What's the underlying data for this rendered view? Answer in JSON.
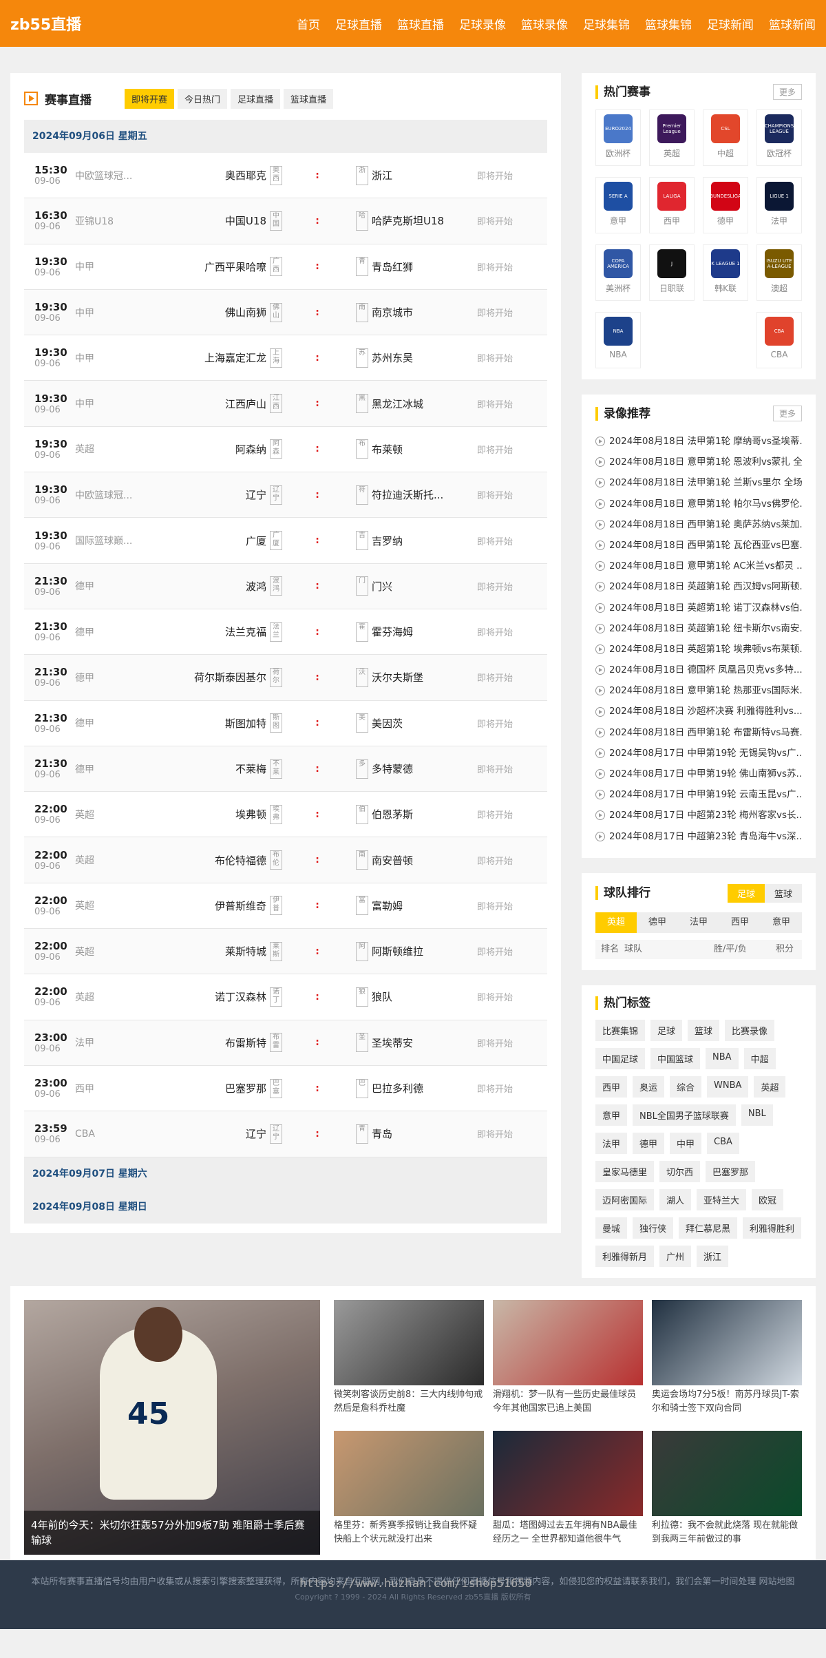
{
  "header": {
    "logo": "zb55直播",
    "nav": [
      "首页",
      "足球直播",
      "篮球直播",
      "足球录像",
      "篮球录像",
      "足球集锦",
      "篮球集锦",
      "足球新闻",
      "篮球新闻"
    ]
  },
  "live": {
    "title": "赛事直播",
    "filters": [
      "即将开赛",
      "今日热门",
      "足球直播",
      "篮球直播"
    ],
    "day1": "2024年09月06日 星期五",
    "day2": "2024年09月07日 星期六",
    "day3": "2024年09月08日 星期日",
    "vs": ":",
    "matches": [
      {
        "time": "15:30",
        "date": "09-06",
        "league": "中欧篮球冠...",
        "home": "奥西耶克",
        "hl": "奥西",
        "al": "浙",
        "away": "浙江",
        "status": "即将开始"
      },
      {
        "time": "16:30",
        "date": "09-06",
        "league": "亚锦U18",
        "home": "中国U18",
        "hl": "中国",
        "al": "哈",
        "away": "哈萨克斯坦U18",
        "status": "即将开始"
      },
      {
        "time": "19:30",
        "date": "09-06",
        "league": "中甲",
        "home": "广西平果哈嘹",
        "hl": "广西",
        "al": "青",
        "away": "青岛红狮",
        "status": "即将开始"
      },
      {
        "time": "19:30",
        "date": "09-06",
        "league": "中甲",
        "home": "佛山南狮",
        "hl": "佛山",
        "al": "南",
        "away": "南京城市",
        "status": "即将开始"
      },
      {
        "time": "19:30",
        "date": "09-06",
        "league": "中甲",
        "home": "上海嘉定汇龙",
        "hl": "上海",
        "al": "苏",
        "away": "苏州东吴",
        "status": "即将开始"
      },
      {
        "time": "19:30",
        "date": "09-06",
        "league": "中甲",
        "home": "江西庐山",
        "hl": "江西",
        "al": "黑",
        "away": "黑龙江冰城",
        "status": "即将开始"
      },
      {
        "time": "19:30",
        "date": "09-06",
        "league": "英超",
        "home": "阿森纳",
        "hl": "阿森",
        "al": "布",
        "away": "布莱顿",
        "status": "即将开始"
      },
      {
        "time": "19:30",
        "date": "09-06",
        "league": "中欧篮球冠...",
        "home": "辽宁",
        "hl": "辽宁",
        "al": "符",
        "away": "符拉迪沃斯托...",
        "status": "即将开始"
      },
      {
        "time": "19:30",
        "date": "09-06",
        "league": "国际篮球巅...",
        "home": "广厦",
        "hl": "广厦",
        "al": "吉",
        "away": "吉罗纳",
        "status": "即将开始"
      },
      {
        "time": "21:30",
        "date": "09-06",
        "league": "德甲",
        "home": "波鸿",
        "hl": "波鸿",
        "al": "门",
        "away": "门兴",
        "status": "即将开始"
      },
      {
        "time": "21:30",
        "date": "09-06",
        "league": "德甲",
        "home": "法兰克福",
        "hl": "法兰",
        "al": "霍",
        "away": "霍芬海姆",
        "status": "即将开始"
      },
      {
        "time": "21:30",
        "date": "09-06",
        "league": "德甲",
        "home": "荷尔斯泰因基尔",
        "hl": "荷尔",
        "al": "沃",
        "away": "沃尔夫斯堡",
        "status": "即将开始"
      },
      {
        "time": "21:30",
        "date": "09-06",
        "league": "德甲",
        "home": "斯图加特",
        "hl": "斯图",
        "al": "美",
        "away": "美因茨",
        "status": "即将开始"
      },
      {
        "time": "21:30",
        "date": "09-06",
        "league": "德甲",
        "home": "不莱梅",
        "hl": "不莱",
        "al": "多",
        "away": "多特蒙德",
        "status": "即将开始"
      },
      {
        "time": "22:00",
        "date": "09-06",
        "league": "英超",
        "home": "埃弗顿",
        "hl": "埃弗",
        "al": "伯",
        "away": "伯恩茅斯",
        "status": "即将开始"
      },
      {
        "time": "22:00",
        "date": "09-06",
        "league": "英超",
        "home": "布伦特福德",
        "hl": "布伦",
        "al": "南",
        "away": "南安普顿",
        "status": "即将开始"
      },
      {
        "time": "22:00",
        "date": "09-06",
        "league": "英超",
        "home": "伊普斯维奇",
        "hl": "伊普",
        "al": "富",
        "away": "富勒姆",
        "status": "即将开始"
      },
      {
        "time": "22:00",
        "date": "09-06",
        "league": "英超",
        "home": "莱斯特城",
        "hl": "莱斯",
        "al": "阿",
        "away": "阿斯顿维拉",
        "status": "即将开始"
      },
      {
        "time": "22:00",
        "date": "09-06",
        "league": "英超",
        "home": "诺丁汉森林",
        "hl": "诺丁",
        "al": "狼",
        "away": "狼队",
        "status": "即将开始"
      },
      {
        "time": "23:00",
        "date": "09-06",
        "league": "法甲",
        "home": "布雷斯特",
        "hl": "布雷",
        "al": "圣",
        "away": "圣埃蒂安",
        "status": "即将开始"
      },
      {
        "time": "23:00",
        "date": "09-06",
        "league": "西甲",
        "home": "巴塞罗那",
        "hl": "巴塞",
        "al": "巴",
        "away": "巴拉多利德",
        "status": "即将开始"
      },
      {
        "time": "23:59",
        "date": "09-06",
        "league": "CBA",
        "home": "辽宁",
        "hl": "辽宁",
        "al": "青",
        "away": "青岛",
        "status": "即将开始"
      }
    ]
  },
  "hot": {
    "title": "热门赛事",
    "more": "更多",
    "leagues": [
      {
        "name": "欧洲杯",
        "color": "#4a78c9",
        "label": "EURO2024"
      },
      {
        "name": "英超",
        "color": "#3d195b",
        "label": "Premier League"
      },
      {
        "name": "中超",
        "color": "#e2472b",
        "label": "CSL"
      },
      {
        "name": "欧冠杯",
        "color": "#1b2a5e",
        "label": "CHAMPIONS LEAGUE"
      },
      {
        "name": "意甲",
        "color": "#1e4fa3",
        "label": "SERIE A"
      },
      {
        "name": "西甲",
        "color": "#e0262f",
        "label": "LALIGA"
      },
      {
        "name": "德甲",
        "color": "#d20515",
        "label": "BUNDESLIGA"
      },
      {
        "name": "法甲",
        "color": "#0b1734",
        "label": "LIGUE 1"
      },
      {
        "name": "美洲杯",
        "color": "#3057a5",
        "label": "COPA AMERICA"
      },
      {
        "name": "日职联",
        "color": "#111111",
        "label": "J"
      },
      {
        "name": "韩K联",
        "color": "#1e3a8a",
        "label": "K LEAGUE 1"
      },
      {
        "name": "澳超",
        "color": "#7a5a00",
        "label": "ISUZU UTE A-LEAGUE"
      },
      {
        "name": "NBA",
        "color": "#1d428a",
        "label": "NBA"
      },
      {
        "name": "",
        "color": "#ffffff",
        "label": ""
      },
      {
        "name": "",
        "color": "#ffffff",
        "label": ""
      },
      {
        "name": "CBA",
        "color": "#e0432c",
        "label": "CBA"
      }
    ]
  },
  "videos": {
    "title": "录像推荐",
    "more": "更多",
    "items": [
      "2024年08月18日 法甲第1轮 摩纳哥vs圣埃蒂...",
      "2024年08月18日 意甲第1轮 恩波利vs蒙扎 全...",
      "2024年08月18日 法甲第1轮 兰斯vs里尔 全场...",
      "2024年08月18日 意甲第1轮 帕尔马vs佛罗伦...",
      "2024年08月18日 西甲第1轮 奥萨苏纳vs莱加...",
      "2024年08月18日 西甲第1轮 瓦伦西亚vs巴塞...",
      "2024年08月18日 意甲第1轮 AC米兰vs都灵 ...",
      "2024年08月18日 英超第1轮 西汉姆vs阿斯顿...",
      "2024年08月18日 英超第1轮 诺丁汉森林vs伯...",
      "2024年08月18日 英超第1轮 纽卡斯尔vs南安...",
      "2024年08月18日 英超第1轮 埃弗顿vs布莱顿...",
      "2024年08月18日 德国杯 凤凰吕贝克vs多特...",
      "2024年08月18日 意甲第1轮 热那亚vs国际米...",
      "2024年08月18日 沙超杯决赛 利雅得胜利vs...",
      "2024年08月18日 西甲第1轮 布雷斯特vs马赛...",
      "2024年08月17日 中甲第19轮 无锡吴钩vs广...",
      "2024年08月17日 中甲第19轮 佛山南狮vs苏...",
      "2024年08月17日 中甲第19轮 云南玉昆vs广...",
      "2024年08月17日 中超第23轮 梅州客家vs长...",
      "2024年08月17日 中超第23轮 青岛海牛vs深..."
    ]
  },
  "rank": {
    "title": "球队排行",
    "tabs": [
      "足球",
      "篮球"
    ],
    "subtabs": [
      "英超",
      "德甲",
      "法甲",
      "西甲",
      "意甲"
    ],
    "cols": [
      "排名",
      "球队",
      "胜/平/负",
      "积分"
    ]
  },
  "tags": {
    "title": "热门标签",
    "items": [
      "比赛集锦",
      "足球",
      "篮球",
      "比赛录像",
      "中国足球",
      "中国篮球",
      "NBA",
      "中超",
      "西甲",
      "奥运",
      "综合",
      "WNBA",
      "英超",
      "意甲",
      "NBL全国男子篮球联赛",
      "NBL",
      "法甲",
      "德甲",
      "中甲",
      "CBA",
      "皇家马德里",
      "切尔西",
      "巴塞罗那",
      "迈阿密国际",
      "湖人",
      "亚特兰大",
      "欧冠",
      "曼城",
      "独行侠",
      "拜仁慕尼黑",
      "利雅得胜利",
      "利雅得新月",
      "广州",
      "浙江"
    ]
  },
  "news": {
    "big": "4年前的今天：米切尔狂轰57分外加9板7助 难阻爵士季后赛输球",
    "big_number": "45",
    "items": [
      {
        "cap": "微笑刺客谈历史前8：三大内线帅句戒 然后是詹科乔杜魔",
        "c1": "#9a9a9a",
        "c2": "#2a2a2a"
      },
      {
        "cap": "滑翔机：梦一队有一些历史最佳球员 今年其他国家已追上美国",
        "c1": "#c8b8a8",
        "c2": "#b83030"
      },
      {
        "cap": "奥运会场均7分5板！南苏丹球员JT-索尔和骑士签下双向合同",
        "c1": "#203040",
        "c2": "#d0d8e0"
      },
      {
        "cap": "格里芬：新秀赛季报销让我自我怀疑 快船上个状元就没打出来",
        "c1": "#c89870",
        "c2": "#6a7060"
      },
      {
        "cap": "甜瓜：塔图姆过去五年拥有NBA最佳 经历之一 全世界都知道他很牛气",
        "c1": "#1a2a3a",
        "c2": "#8a2a2a"
      },
      {
        "cap": "利拉德：我不会就此烧落 现在就能做到我两三年前做过的事",
        "c1": "#3a3a3a",
        "c2": "#0a4a2a"
      }
    ]
  },
  "footer": {
    "text": "本站所有赛事直播信号均由用户收集或从搜索引擎搜索整理获得，所有内容均来自互联网，我们自身不提供任何直播信号和视频内容，如侵犯您的权益请联系我们，我们会第一时间处理 网站地图",
    "copy": "Copyright ? 1999 - 2024 All Rights Reserved zb55直播 版权所有",
    "watermark": "https://www.huzhan.com/ishop51650"
  }
}
